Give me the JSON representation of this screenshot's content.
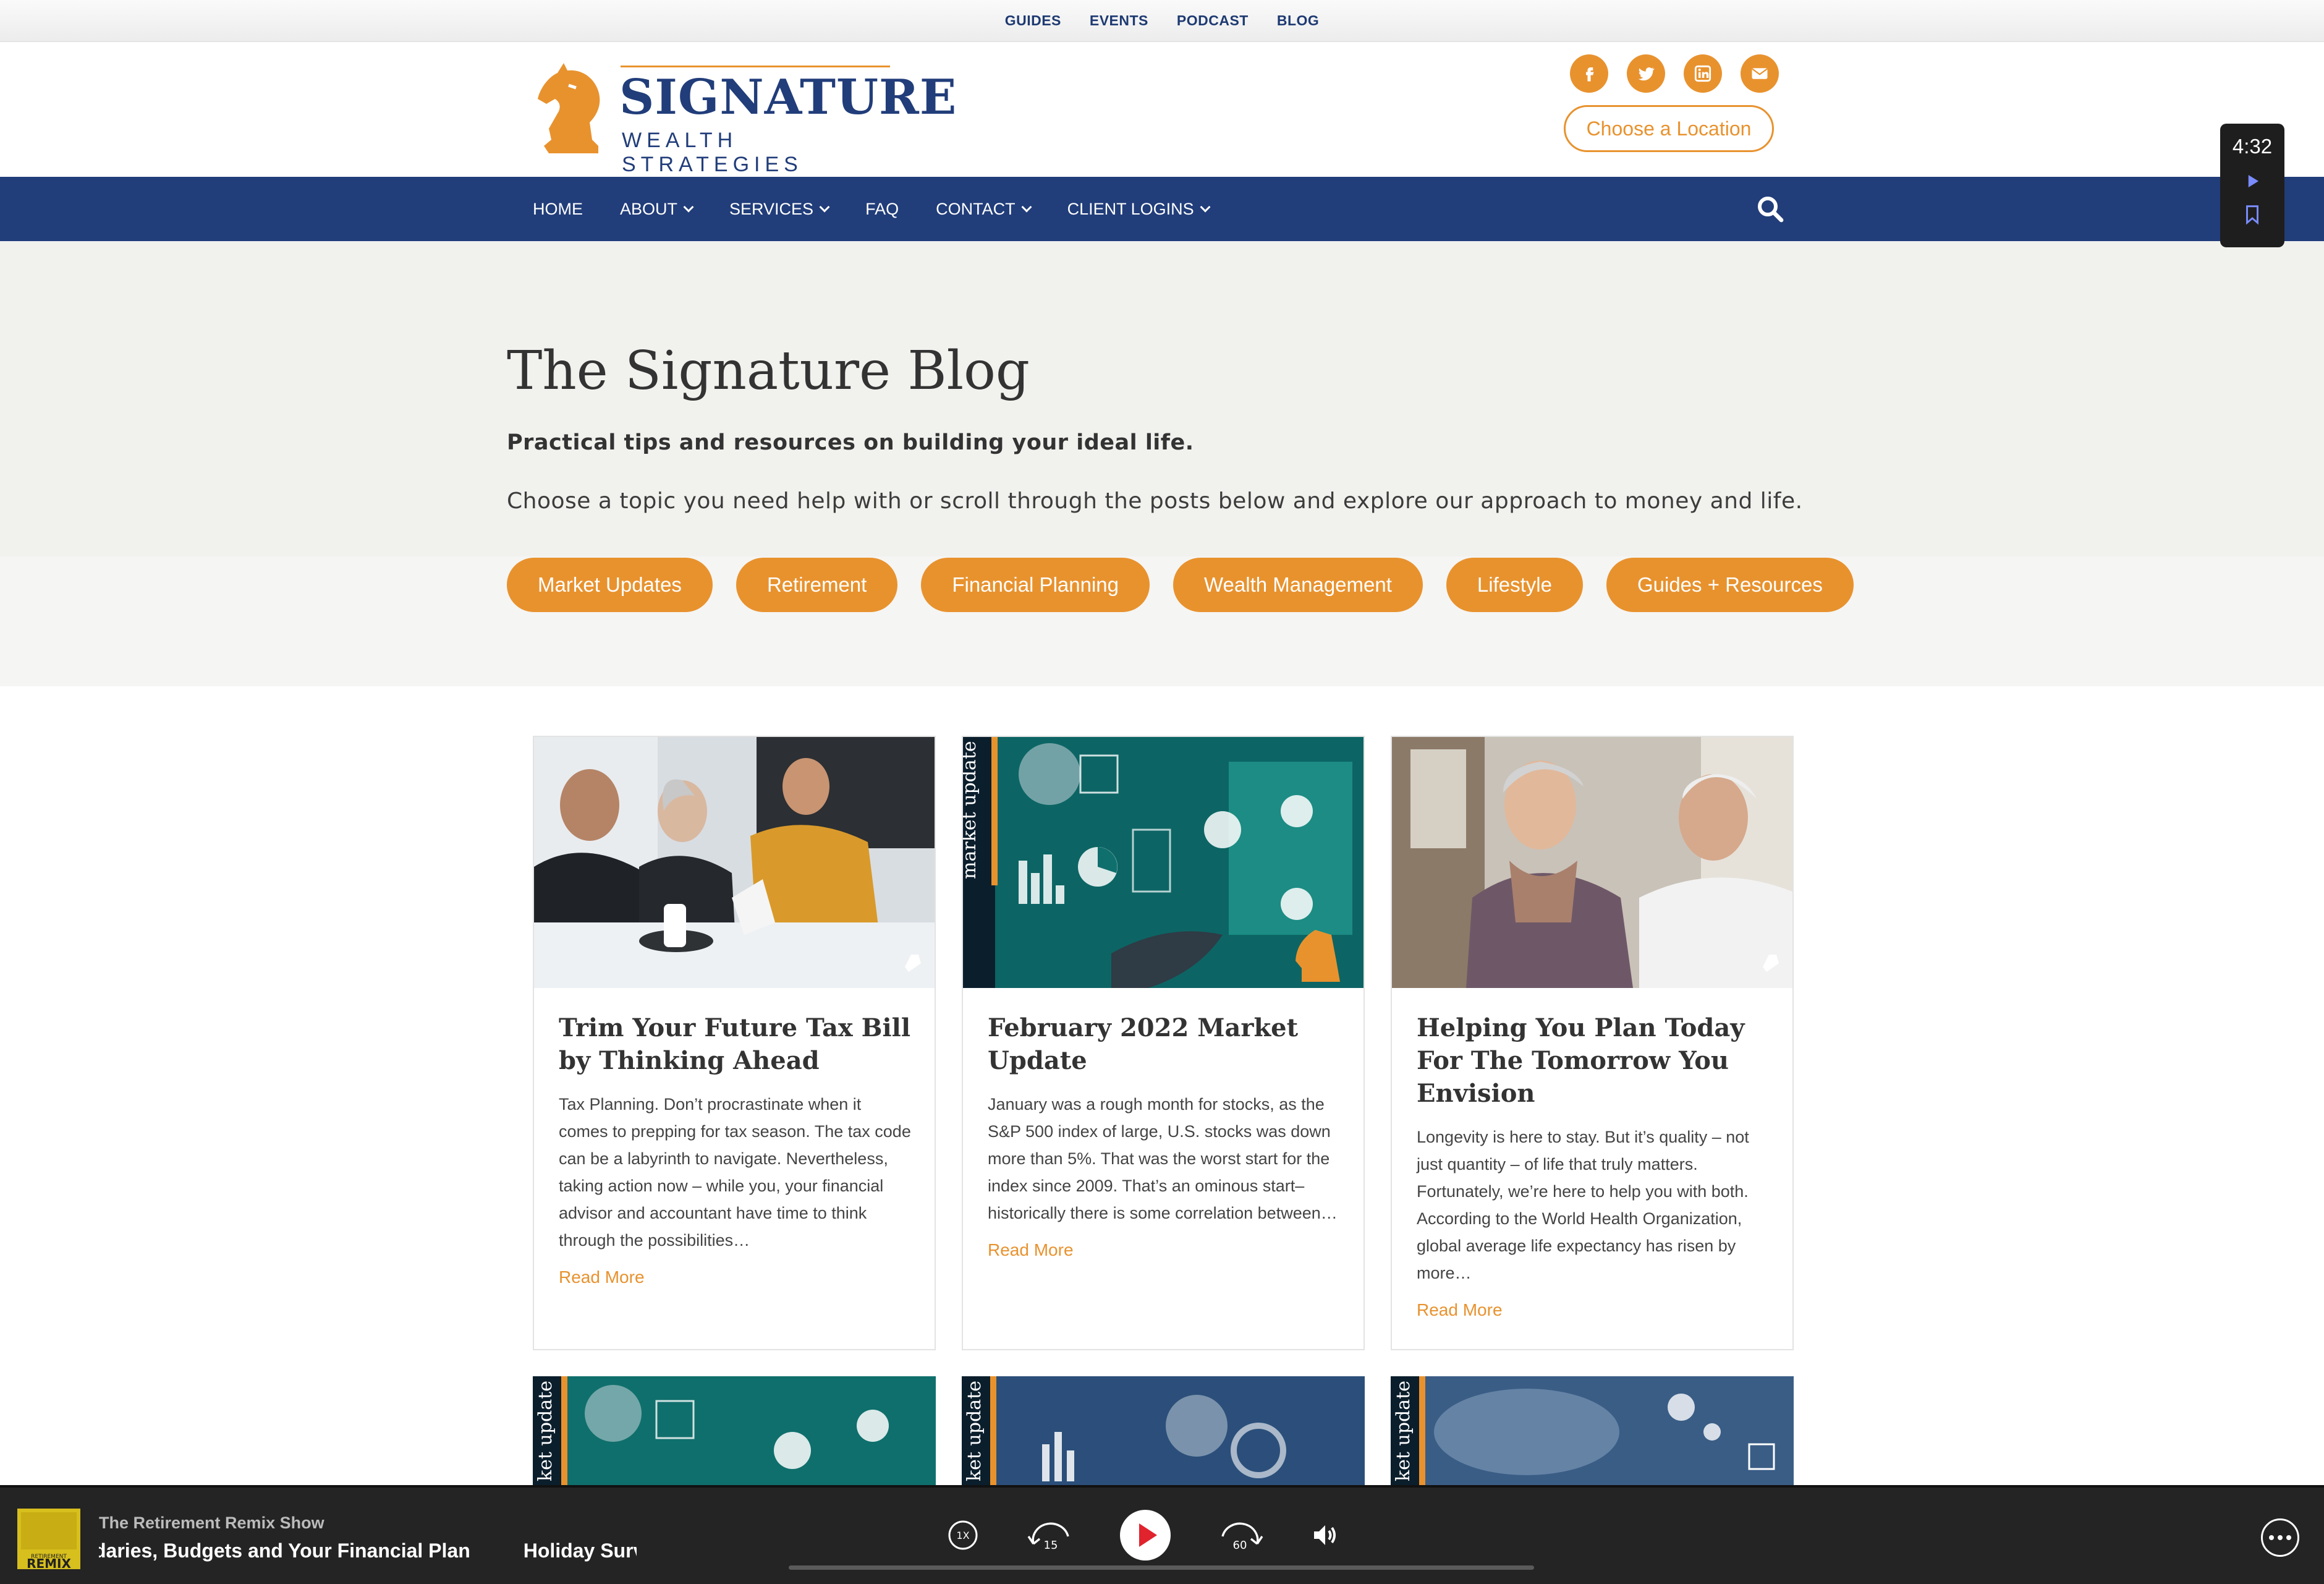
{
  "utility_nav": [
    "GUIDES",
    "EVENTS",
    "PODCAST",
    "BLOG"
  ],
  "logo": {
    "wordmark": "SIGNATURE",
    "tagline": "WEALTH STRATEGIES"
  },
  "social_icons": [
    "facebook-icon",
    "twitter-icon",
    "linkedin-icon",
    "email-icon"
  ],
  "location_button": "Choose a Location",
  "main_nav": [
    {
      "label": "HOME",
      "dropdown": false
    },
    {
      "label": "ABOUT",
      "dropdown": true
    },
    {
      "label": "SERVICES",
      "dropdown": true
    },
    {
      "label": "FAQ",
      "dropdown": false
    },
    {
      "label": "CONTACT",
      "dropdown": true
    },
    {
      "label": "CLIENT LOGINS",
      "dropdown": true
    }
  ],
  "hero": {
    "title": "The Signature Blog",
    "subtitle": "Practical tips and resources on building your ideal life.",
    "description": "Choose a topic you need help with or scroll through the posts below and explore our approach to money and life.",
    "topics": [
      "Market Updates",
      "Retirement",
      "Financial Planning",
      "Wealth Management",
      "Lifestyle",
      "Guides + Resources"
    ]
  },
  "posts": [
    {
      "title": "Trim Your Future Tax Bill by Thinking Ahead",
      "excerpt": "Tax Planning. Don’t procrastinate when it comes to prepping for tax season. The tax code can be a labyrinth to navigate. Nevertheless, taking action now – while you, your financial advisor and accountant have time to think through the possibilities…",
      "read_more": "Read More"
    },
    {
      "title": "February 2022 Market Update",
      "excerpt": "January was a rough month for stocks, as the S&P 500 index of large, U.S. stocks was down more than 5%.  That was the worst start for the index since 2009.  That’s an ominous start–historically there is some correlation between…",
      "read_more": "Read More",
      "image_tag": "market update"
    },
    {
      "title": "Helping You Plan Today For The Tomorrow You Envision",
      "excerpt": "Longevity is here to stay. But it’s quality – not just quantity – of life that truly matters. Fortunately, we’re here to help you with both. According to the World Health Organization, global average life expectancy has risen by more…",
      "read_more": "Read More"
    }
  ],
  "posts_row2_tags": [
    "ket update",
    "ket update",
    "ket update"
  ],
  "time_widget": {
    "time": "4:32"
  },
  "player": {
    "show": "The Retirement Remix Show",
    "episode_fragment_1": "daries, Budgets and Your Financial Plan",
    "episode_fragment_2": "Holiday Surviva",
    "thumb_text": "REMIX",
    "thumb_small": "RETIREMENT",
    "speed": "1X",
    "skip_back": "15",
    "skip_forward": "60"
  },
  "colors": {
    "brand_navy": "#213d7a",
    "accent_orange": "#e8922e",
    "player_red": "#e0232d"
  }
}
